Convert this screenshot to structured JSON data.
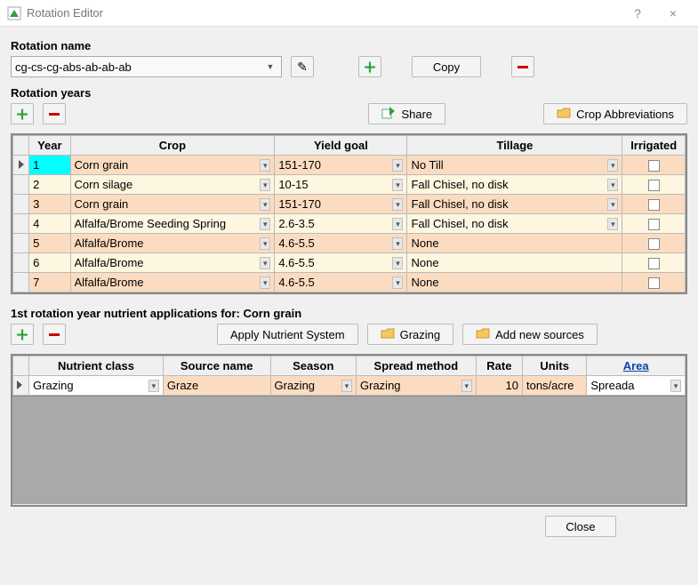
{
  "window": {
    "title": "Rotation Editor",
    "help": "?",
    "close": "×"
  },
  "rotation_name_label": "Rotation name",
  "rotation_name_value": "cg-cs-cg-abs-ab-ab-ab",
  "copy_btn": "Copy",
  "rotation_years_label": "Rotation years",
  "share_btn": "Share",
  "abbrev_btn": "Crop Abbreviations",
  "grid1": {
    "headers": {
      "year": "Year",
      "crop": "Crop",
      "yield": "Yield goal",
      "tillage": "Tillage",
      "irrigated": "Irrigated"
    },
    "rows": [
      {
        "year": "1",
        "crop": "Corn grain",
        "yield": "151-170",
        "tillage": "No Till",
        "selected": true,
        "shade": "orange"
      },
      {
        "year": "2",
        "crop": "Corn silage",
        "yield": "10-15",
        "tillage": "Fall Chisel, no disk",
        "shade": "pale"
      },
      {
        "year": "3",
        "crop": "Corn grain",
        "yield": "151-170",
        "tillage": "Fall Chisel, no disk",
        "shade": "orange"
      },
      {
        "year": "4",
        "crop": "Alfalfa/Brome Seeding Spring",
        "yield": "2.6-3.5",
        "tillage": "Fall Chisel, no disk",
        "shade": "pale"
      },
      {
        "year": "5",
        "crop": "Alfalfa/Brome",
        "yield": "4.6-5.5",
        "tillage": "None",
        "shade": "orange"
      },
      {
        "year": "6",
        "crop": "Alfalfa/Brome",
        "yield": "4.6-5.5",
        "tillage": "None",
        "shade": "pale"
      },
      {
        "year": "7",
        "crop": "Alfalfa/Brome",
        "yield": "4.6-5.5",
        "tillage": "None",
        "shade": "orange"
      }
    ]
  },
  "nutrient_title": "1st rotation year nutrient applications for: Corn grain",
  "apply_nutrient_btn": "Apply Nutrient System",
  "grazing_btn": "Grazing",
  "add_sources_btn": "Add new sources",
  "grid2": {
    "headers": {
      "class": "Nutrient class",
      "source": "Source name",
      "season": "Season",
      "spread": "Spread method",
      "rate": "Rate",
      "units": "Units",
      "area": "Area"
    },
    "rows": [
      {
        "class": "Grazing",
        "source": "Graze",
        "season": "Grazing",
        "spread": "Grazing",
        "rate": "10",
        "units": "tons/acre",
        "area": "Spreada"
      }
    ]
  },
  "close_btn": "Close"
}
